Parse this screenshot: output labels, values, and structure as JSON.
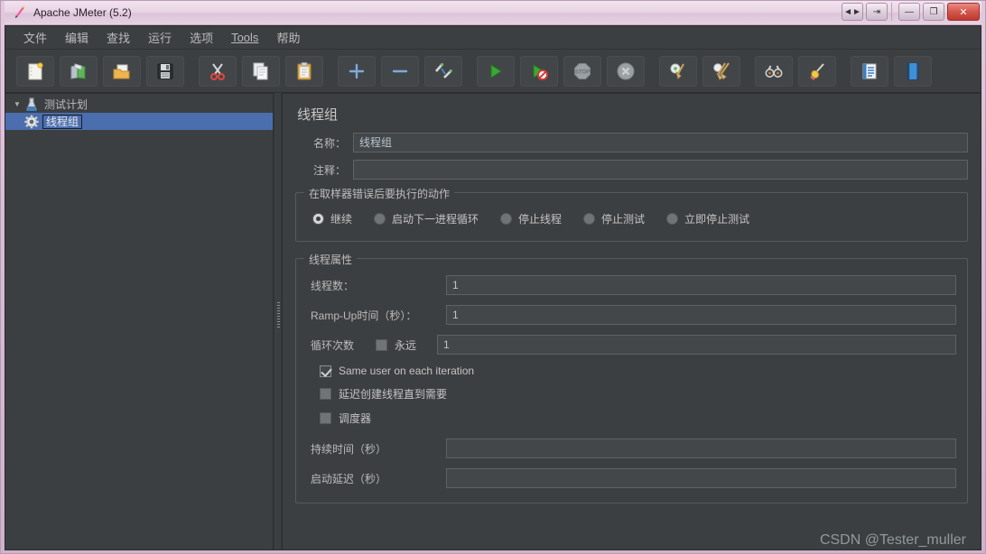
{
  "window": {
    "title": "Apache JMeter (5.2)",
    "app_icon": "jmeter-feather-icon",
    "controls": {
      "restore_side": "◄►",
      "detach": "⇥",
      "minimize": "—",
      "maximize": "❐",
      "close": "✕"
    }
  },
  "menubar": {
    "items": [
      {
        "label": "文件",
        "mnemonic": false
      },
      {
        "label": "编辑",
        "mnemonic": false
      },
      {
        "label": "查找",
        "mnemonic": false
      },
      {
        "label": "运行",
        "mnemonic": false
      },
      {
        "label": "选项",
        "mnemonic": false
      },
      {
        "label": "Tools",
        "mnemonic": true
      },
      {
        "label": "帮助",
        "mnemonic": false
      }
    ]
  },
  "toolbar": {
    "buttons": [
      {
        "name": "new-test-plan",
        "icon": "new-document-icon"
      },
      {
        "name": "templates",
        "icon": "templates-books-icon"
      },
      {
        "name": "open",
        "icon": "open-folder-icon"
      },
      {
        "name": "save",
        "icon": "save-floppy-icon"
      },
      {
        "name": "cut",
        "icon": "scissors-icon"
      },
      {
        "name": "copy",
        "icon": "copy-pages-icon"
      },
      {
        "name": "paste",
        "icon": "clipboard-icon"
      },
      {
        "name": "expand-all",
        "icon": "plus-icon"
      },
      {
        "name": "collapse-all",
        "icon": "minus-icon"
      },
      {
        "name": "toggle",
        "icon": "toggle-pencil-icon"
      },
      {
        "name": "start",
        "icon": "play-green-icon"
      },
      {
        "name": "start-no-timers",
        "icon": "play-no-timers-icon"
      },
      {
        "name": "stop",
        "icon": "stop-sign-icon"
      },
      {
        "name": "shutdown",
        "icon": "shutdown-x-icon"
      },
      {
        "name": "clear",
        "icon": "gear-broom-icon"
      },
      {
        "name": "clear-all",
        "icon": "double-broom-icon"
      },
      {
        "name": "search",
        "icon": "binoculars-icon"
      },
      {
        "name": "reset-search",
        "icon": "bell-broom-icon"
      },
      {
        "name": "function-helper",
        "icon": "list-notes-icon"
      },
      {
        "name": "help",
        "icon": "book-blue-icon"
      }
    ]
  },
  "tree": {
    "nodes": [
      {
        "label": "测试计划",
        "icon": "test-plan-icon",
        "expanded": true,
        "selected": false,
        "arrow": "▼"
      },
      {
        "label": "线程组",
        "icon": "thread-group-gear-icon",
        "expanded": false,
        "selected": true,
        "arrow": ""
      }
    ]
  },
  "main": {
    "panel_title": "线程组",
    "name": {
      "label": "名称：",
      "value": "线程组"
    },
    "comment": {
      "label": "注释：",
      "value": ""
    },
    "on_error": {
      "group_title": "在取样器错误后要执行的动作",
      "options": [
        {
          "label": "继续",
          "checked": true
        },
        {
          "label": "启动下一进程循环",
          "checked": false
        },
        {
          "label": "停止线程",
          "checked": false
        },
        {
          "label": "停止测试",
          "checked": false
        },
        {
          "label": "立即停止测试",
          "checked": false
        }
      ]
    },
    "thread_properties": {
      "group_title": "线程属性",
      "num_threads": {
        "label": "线程数：",
        "value": "1"
      },
      "ramp_up": {
        "label": "Ramp-Up时间（秒）：",
        "value": "1"
      },
      "loop_count": {
        "label": "循环次数",
        "forever_label": "永远",
        "forever_checked": false,
        "value": "1"
      },
      "checkboxes": [
        {
          "label": "Same user on each iteration",
          "checked": true
        },
        {
          "label": "延迟创建线程直到需要",
          "checked": false
        },
        {
          "label": "调度器",
          "checked": false
        }
      ],
      "duration": {
        "label": "持续时间（秒）",
        "value": ""
      },
      "startup_delay": {
        "label": "启动延迟（秒）",
        "value": ""
      }
    }
  },
  "watermark": {
    "text": "CSDN @Tester_muller"
  },
  "colors": {
    "panel_bg": "#3c3f41",
    "field_bg": "#43474a",
    "selection_blue": "#4b6eaf",
    "text": "#bbbbbb",
    "frame": "#d9bcd4"
  }
}
